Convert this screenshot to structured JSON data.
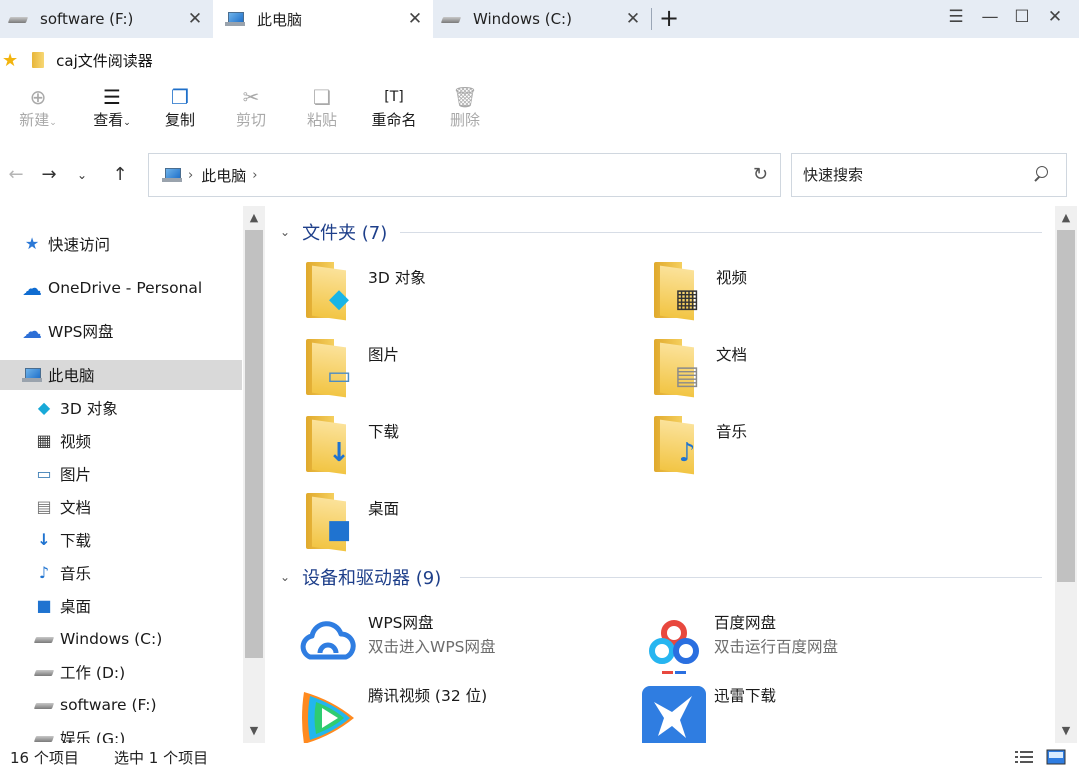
{
  "tabs": [
    {
      "label": "software (F:)",
      "active": false
    },
    {
      "label": "此电脑",
      "active": true
    },
    {
      "label": "Windows (C:)",
      "active": false
    }
  ],
  "window_controls": {
    "menu": "☰",
    "minimize": "—",
    "maximize": "☐",
    "close": "✕"
  },
  "location": {
    "label": "caj文件阅读器"
  },
  "toolbar": {
    "new": "新建",
    "view": "查看",
    "copy": "复制",
    "cut": "剪切",
    "paste": "粘贴",
    "rename": "重命名",
    "delete": "删除"
  },
  "address": {
    "crumb": "此电脑"
  },
  "search": {
    "placeholder": "快速搜索"
  },
  "navpane": {
    "items": [
      {
        "label": "快速访问",
        "icon": "star-icon"
      },
      {
        "label": "OneDrive - Personal",
        "icon": "cloud-icon"
      },
      {
        "label": "WPS网盘",
        "icon": "wps-cloud-icon"
      },
      {
        "label": "此电脑",
        "icon": "computer-icon",
        "selected": true
      },
      {
        "label": "3D 对象",
        "icon": "cube-icon"
      },
      {
        "label": "视频",
        "icon": "film-icon"
      },
      {
        "label": "图片",
        "icon": "picture-icon"
      },
      {
        "label": "文档",
        "icon": "document-icon"
      },
      {
        "label": "下载",
        "icon": "download-icon"
      },
      {
        "label": "音乐",
        "icon": "music-icon"
      },
      {
        "label": "桌面",
        "icon": "desktop-icon"
      },
      {
        "label": "Windows (C:)",
        "icon": "drive-icon"
      },
      {
        "label": "工作 (D:)",
        "icon": "drive-icon"
      },
      {
        "label": "software (F:)",
        "icon": "drive-icon"
      },
      {
        "label": "娱乐 (G:)",
        "icon": "drive-icon"
      }
    ]
  },
  "content": {
    "folders_group": {
      "title": "文件夹 (7)"
    },
    "folders": [
      {
        "label": "3D 对象",
        "icon": "cube-folder-icon"
      },
      {
        "label": "视频",
        "icon": "video-folder-icon"
      },
      {
        "label": "图片",
        "icon": "picture-folder-icon"
      },
      {
        "label": "文档",
        "icon": "document-folder-icon"
      },
      {
        "label": "下载",
        "icon": "download-folder-icon"
      },
      {
        "label": "音乐",
        "icon": "music-folder-icon"
      },
      {
        "label": "桌面",
        "icon": "desktop-folder-icon"
      }
    ],
    "devices_group": {
      "title": "设备和驱动器 (9)"
    },
    "devices": [
      {
        "name": "WPS网盘",
        "sub": "双击进入WPS网盘",
        "icon": "wps-cloud-icon"
      },
      {
        "name": "百度网盘",
        "sub": "双击运行百度网盘",
        "icon": "baidu-netdisk-icon"
      },
      {
        "name": "腾讯视频 (32 位)",
        "sub": "",
        "icon": "tencent-video-icon"
      },
      {
        "name": "迅雷下载",
        "sub": "",
        "icon": "xunlei-icon"
      }
    ]
  },
  "status": {
    "count": "16 个项目",
    "selected": "选中 1 个项目"
  },
  "colors": {
    "accent": "#1e3f8a",
    "selection": "#d9d9d9",
    "tabbar": "#e6ecf4"
  }
}
